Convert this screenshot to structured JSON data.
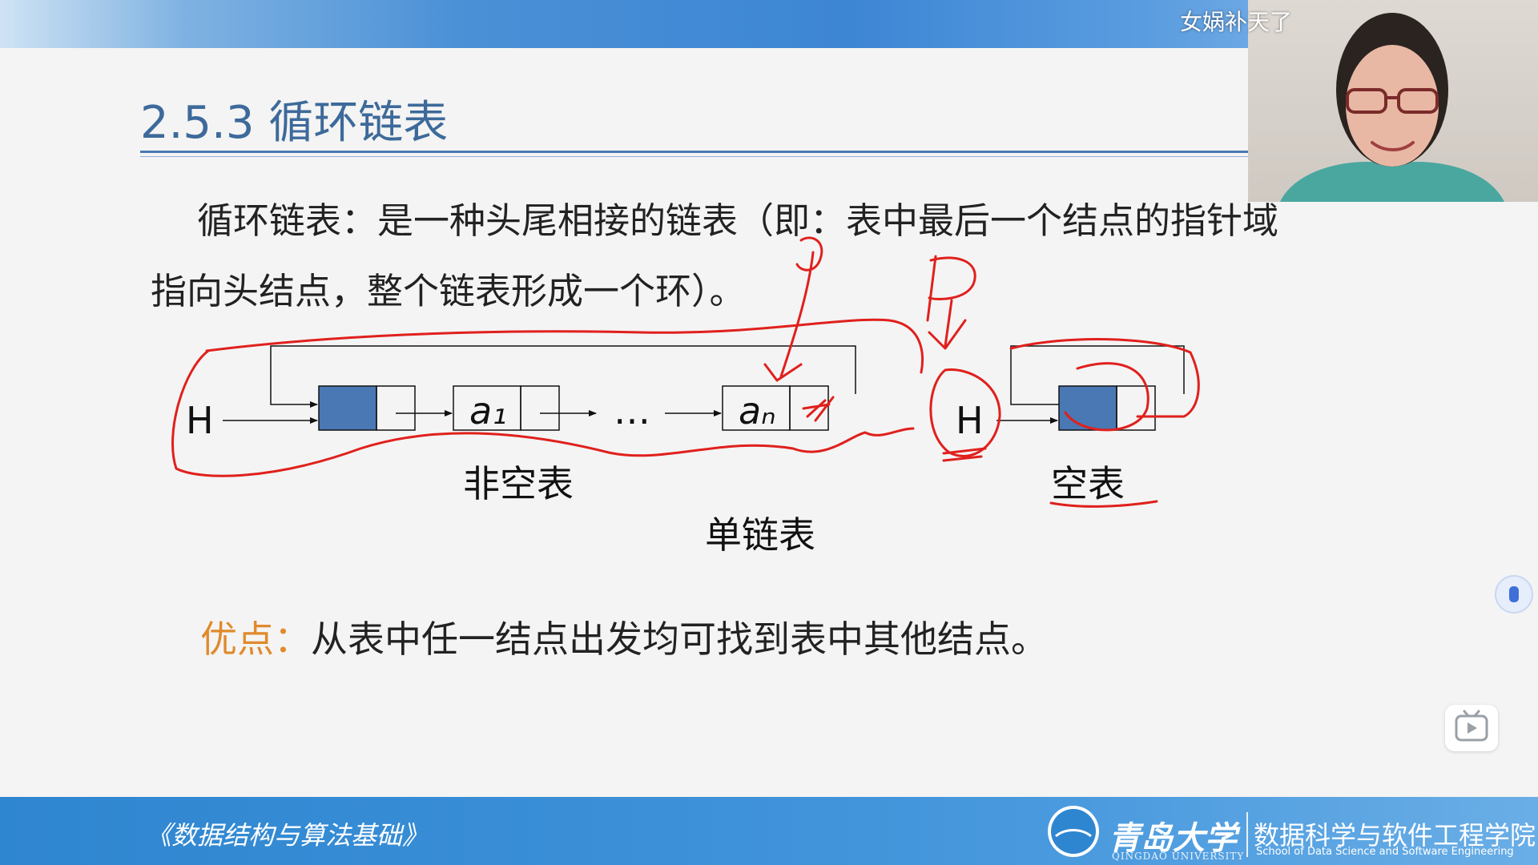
{
  "overlay": {
    "uploader_name": "女娲补天了"
  },
  "slide": {
    "title": "2.5.3 循环链表",
    "definition_line1": "循环链表：是一种头尾相接的链表（即：表中最后一个结点的指针域",
    "definition_line2": "指向头结点，整个链表形成一个环）。",
    "diagram": {
      "head_label": "H",
      "node_a1": "a₁",
      "ellipsis": "…",
      "node_an": "aₙ",
      "empty_head_label": "H",
      "nonempty_caption": "非空表",
      "empty_caption": "空表",
      "subtitle": "单链表",
      "handwritten_p1": "P",
      "handwritten_p2": "P",
      "node_color": "#4a78b4",
      "annotation_color": "#e0201c"
    },
    "advantage_label": "优点：",
    "advantage_text": "从表中任一结点出发均可找到表中其他结点。",
    "accent_color": "#e08a2c"
  },
  "footer": {
    "course_title": "《数据结构与算法基础》",
    "university_name": "青岛大学",
    "university_name_en": "QINGDAO UNIVERSITY",
    "school_name": "数据科学与软件工程学院",
    "school_name_en": "School of Data Science and Software Engineering"
  },
  "controls": {
    "play_icon": "play-icon",
    "side_icon": "plugin-icon"
  }
}
